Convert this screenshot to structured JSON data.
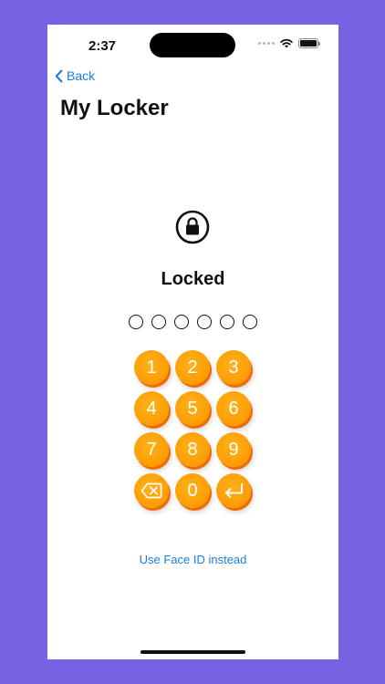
{
  "status_bar": {
    "time": "2:37",
    "icons": [
      "signal-dots-icon",
      "wifi-icon",
      "battery-icon"
    ]
  },
  "nav": {
    "back_label": "Back",
    "title": "My Locker"
  },
  "lock": {
    "icon": "lock-icon",
    "status": "Locked",
    "pin_length": 6,
    "pin_entered": 0
  },
  "keypad": {
    "keys": [
      "1",
      "2",
      "3",
      "4",
      "5",
      "6",
      "7",
      "8",
      "9",
      "delete",
      "0",
      "enter"
    ],
    "delete_icon": "backspace-icon",
    "enter_icon": "return-icon"
  },
  "face_id_label": "Use Face ID instead",
  "colors": {
    "background": "#7862e4",
    "accent_link": "#1a7ee0",
    "key_orange": "#ff9f06",
    "key_shadow": "#f06c00"
  }
}
